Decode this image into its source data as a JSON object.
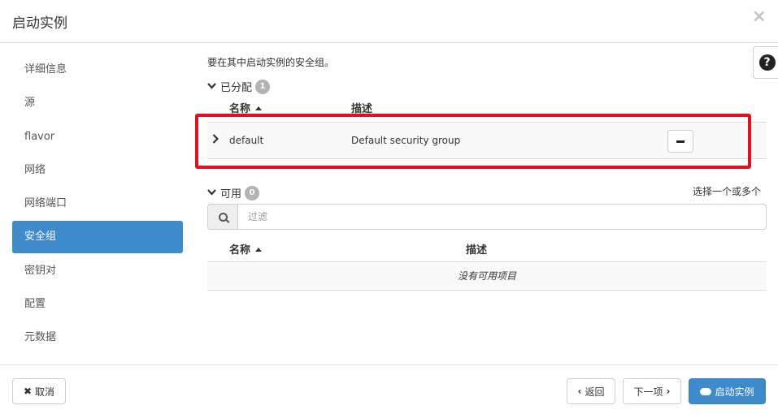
{
  "modal": {
    "title": "启动实例",
    "close_glyph": "×"
  },
  "sidebar": {
    "items": [
      {
        "label": "详细信息"
      },
      {
        "label": "源"
      },
      {
        "label": "flavor"
      },
      {
        "label": "网络"
      },
      {
        "label": "网络端口"
      },
      {
        "label": "安全组",
        "active": true
      },
      {
        "label": "密钥对"
      },
      {
        "label": "配置"
      },
      {
        "label": "元数据"
      }
    ]
  },
  "help": {
    "glyph": "?"
  },
  "main": {
    "description": "要在其中启动实例的安全组。",
    "allocated": {
      "label": "已分配",
      "count": "1",
      "columns": {
        "name": "名称",
        "description": "描述"
      },
      "rows": [
        {
          "name": "default",
          "description": "Default security group"
        }
      ]
    },
    "available": {
      "label": "可用",
      "count": "0",
      "hint": "选择一个或多个",
      "filter_placeholder": "过滤",
      "columns": {
        "name": "名称",
        "description": "描述"
      },
      "empty_text": "没有可用项目"
    }
  },
  "footer": {
    "cancel": "取消",
    "back": "返回",
    "next": "下一项",
    "launch": "启动实例"
  },
  "colors": {
    "accent": "#3f8acb",
    "highlight": "#e0101e"
  }
}
